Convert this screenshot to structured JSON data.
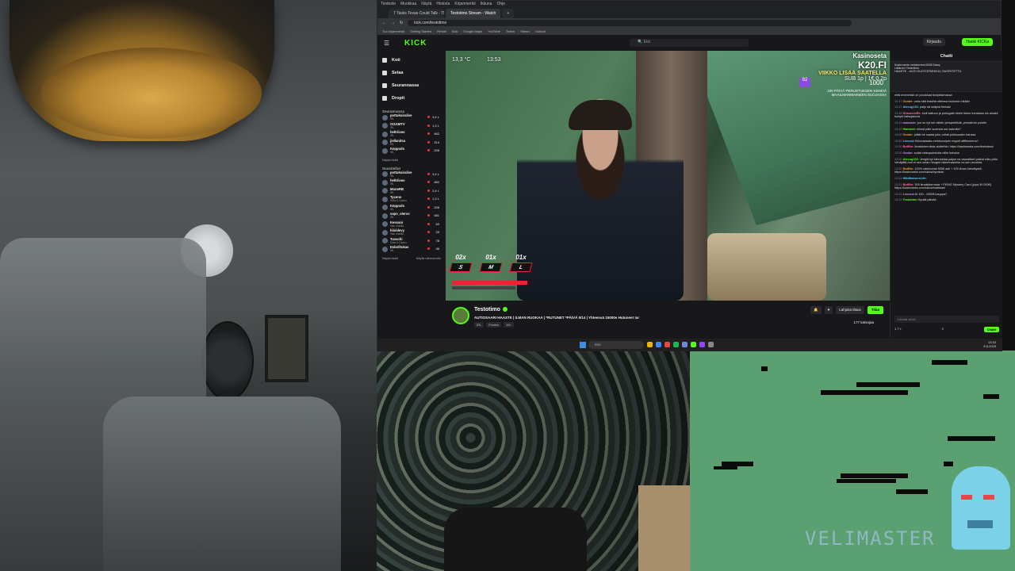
{
  "browser": {
    "tabs": [
      "7 Tasks Texas Could Talk - The",
      "Testotimo Stream - Watch",
      "+"
    ],
    "url": "kick.com/testotimo",
    "bookmarks": [
      "Tuo kirjanmerkit",
      "Getting Started",
      "Reddit",
      "Kick",
      "Google Maps",
      "YouTube",
      "Twitch",
      "Steam",
      "Outlook"
    ]
  },
  "kick": {
    "logo": "KICK",
    "search_placeholder": "Etsi",
    "login_label": "Kirjaudu",
    "signup_label": "Hanki KICKa",
    "nav": [
      {
        "label": "Koti"
      },
      {
        "label": "Selaa"
      },
      {
        "label": "Seurannassa"
      },
      {
        "label": "Dropit"
      }
    ],
    "following_header": "Seurannassa",
    "following": [
      {
        "name": "pottukoiralive",
        "sub": "IRL",
        "viewers": "3,4 t."
      },
      {
        "name": "OGGMTV",
        "sub": "IRL",
        "viewers": "1,3 t."
      },
      {
        "name": "heltriiseo",
        "sub": "IRL",
        "viewers": "462"
      },
      {
        "name": "jiellanitsa",
        "sub": "IRL",
        "viewers": "313"
      },
      {
        "name": "Keppodo",
        "sub": "IRL",
        "viewers": "228"
      }
    ],
    "show_more": "Näytä lisää",
    "recommended_header": "Suositellut",
    "recommended": [
      {
        "name": "pottukoiralive",
        "sub": "IRL",
        "viewers": "3,4 t."
      },
      {
        "name": "heltriiseo",
        "sub": "IRL",
        "viewers": "462"
      },
      {
        "name": "MoneRB",
        "sub": "IRL",
        "viewers": "2,4 t."
      },
      {
        "name": "Tyceno",
        "sub": "Slots & Casino",
        "viewers": "1,3 t."
      },
      {
        "name": "Keppodo",
        "sub": "IRL",
        "viewers": "228"
      },
      {
        "name": "sapo_olervo",
        "sub": "IRL",
        "viewers": "481"
      },
      {
        "name": "Kessani",
        "sub": "Vain chatilla",
        "viewers": "63"
      },
      {
        "name": "hiisidevy",
        "sub": "Vain chatilla",
        "viewers": "25"
      },
      {
        "name": "Tuvachi",
        "sub": "Slots & Casino",
        "viewers": "78"
      },
      {
        "name": "Esbolltokas",
        "sub": "IRL",
        "viewers": "36"
      }
    ],
    "show_more_2": "Näytä lisää",
    "show_less": "Näytä vähemmän"
  },
  "overlay": {
    "temperature": "13,3 °C",
    "time": "13:53",
    "brand_line1": "Kasinoseta",
    "brand_line2": "K20.FI",
    "brand_line3": "VIIKKO LISÄÄ SAATELLA",
    "brand_line4": "SUB 1p | 1€ 0,2p",
    "badge_num": "82",
    "sub_count": "1000",
    "small_text": "100 PÄIVÄ PERUSTUKSEN KENKIÄ MAAILMANMAINEEN SUOJASSA",
    "counters": [
      {
        "count": "02x",
        "key": "S"
      },
      {
        "count": "01x",
        "key": "M"
      },
      {
        "count": "01x",
        "key": "L"
      }
    ]
  },
  "stream_info": {
    "streamer": "Testotimo",
    "title": "AUTIOSAARI HAASTE | ILMAN RUOKAA | *RUTUNET *PÄIVÄ 5/14 | Yhteensä 15000e Hutuneet !ar",
    "tags": [
      "IRL",
      "Finnish",
      "18+"
    ],
    "follow_label": "Lahjoita tilaus",
    "subscribe_label": "Tilaa",
    "viewers": "177 katsojaa"
  },
  "chat": {
    "title": "Chatti",
    "pinned": "Kasinoseta  metalemies1598  Kasq\nLätänen   Testotimo\nHAASTE - UUSI KUOTOPARKKA | SUORITETTU",
    "messages": [
      {
        "ts": "",
        "user": "",
        "text": "mitä enemmän on porukkaa tulojottamassa"
      },
      {
        "ts": "13.47",
        "user": "Gosbe:",
        "text": "onks sitä brasilia otteissa kuulunut mitään"
      },
      {
        "ts": "13.47",
        "user": "Alecog133:",
        "text": "paljo sä snäpist tienaat"
      },
      {
        "ts": "13.48",
        "user": "DhannesiRk:",
        "text": "kioli kaltuun ja portugalin kielel tekee kontassa ois ainakii kompit katsojaluvia"
      },
      {
        "ts": "13.49",
        "user": "aumsarh:",
        "text": "joo no nyt tuli vähän perspektiiviä, ymmärrän pointin"
      },
      {
        "ts": "13.49",
        "user": "Hammot:",
        "text": "missä päin suomea oot saarella?"
      },
      {
        "ts": "13.50",
        "user": "Gosbe:",
        "text": "pitää vie saada joku collab julkisuuden kanssa"
      },
      {
        "ts": "13.50",
        "user": "Lensosi",
        "text": "Kiinnostaako verkkovuipen myynti affilieneena?"
      },
      {
        "ts": "13.50",
        "user": "BotRtx:",
        "text": "Ilmaiskierroksia slotteihin: https://kasinoseta.com/testotimo/"
      },
      {
        "ts": "13.50",
        "user": "Gosbe:",
        "text": "soitat videopuheluita niille hahaha"
      },
      {
        "ts": "13.50",
        "user": "Alecog133:",
        "text": "Jengiä kyl kiinnostaa paljon na vaaralliset paikat niiku jottu Venäjällä mut ei sen oman hengen riskeeraamine oo sen arvoista."
      },
      {
        "ts": "13.50",
        "user": "BotRtx:",
        "text": "100% rakebonist 500€ asti + 100 ilman kierrätystä: https://kasinoseta.com/skinz/hyvaksi/"
      },
      {
        "ts": "13.51",
        "user": "WildNaturesLife:",
        "text": ""
      },
      {
        "ts": "13.51",
        "user": "BotRtx:",
        "text": "300 ilmaiskierrosta + FKING Mystery Card (jopa 50 000€) https://kasinoseta.com/skinz/markkari/"
      },
      {
        "ts": "13.52",
        "user": "Lensosi",
        "text": "Ai 100 - 1000€ kauppa?"
      },
      {
        "ts": "13.52",
        "user": "Testotimo",
        "text": "Hyvää päivää"
      }
    ],
    "input_placeholder": "Lähetä viesti",
    "footer_points": "1,7 t.",
    "footer_count": "0",
    "send_label": "Chatti"
  },
  "taskbar": {
    "search_placeholder": "Etsi",
    "time": "13.53",
    "date": "8.8.2025"
  },
  "game": {
    "watermark": "VELIMASTER"
  },
  "colors": {
    "kick_green": "#53fc18",
    "dark_bg": "#18181b",
    "retro_green": "#5ba071"
  }
}
